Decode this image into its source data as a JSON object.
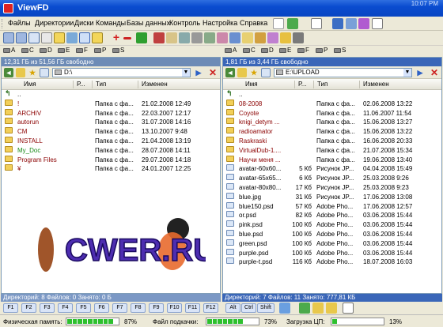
{
  "window": {
    "title": "ViewFD",
    "corner_text": "10:07 PM"
  },
  "menu": [
    "Файлы",
    "Директории",
    "Диски",
    "Команды",
    "Базы данных",
    "Контроль",
    "Настройка",
    "Справка"
  ],
  "drives": [
    "A",
    "C",
    "D",
    "E",
    "F",
    "P",
    "S"
  ],
  "left": {
    "free": "12,31 ГБ из 51,56 ГБ свободно",
    "path": "D:\\",
    "cols": {
      "name": "Имя",
      "size": "Р...",
      "type": "Тип",
      "modified": "Изменен"
    },
    "rows": [
      {
        "name": "..",
        "size": "",
        "type": "",
        "date": "",
        "kind": "up",
        "color": "#000"
      },
      {
        "name": "!",
        "size": "",
        "type": "Папка с фа...",
        "date": "21.02.2008 12:49",
        "kind": "dir",
        "color": "#8b0000"
      },
      {
        "name": "ARCHIV",
        "size": "",
        "type": "Папка с фа...",
        "date": "22.03.2007 12:17",
        "kind": "dir",
        "color": "#8b0000"
      },
      {
        "name": "autorun",
        "size": "",
        "type": "Папка с фа...",
        "date": "31.07.2008 14:16",
        "kind": "dir",
        "color": "#8b0000"
      },
      {
        "name": "CM",
        "size": "",
        "type": "Папка с фа...",
        "date": "13.10.2007 9:48",
        "kind": "dir",
        "color": "#8b0000"
      },
      {
        "name": "INSTALL",
        "size": "",
        "type": "Папка с фа...",
        "date": "21.04.2008 13:19",
        "kind": "dir",
        "color": "#8b0000"
      },
      {
        "name": "My_Doc",
        "size": "",
        "type": "Папка с фа...",
        "date": "28.07.2008 14:11",
        "kind": "dir",
        "color": "#1a8a1a"
      },
      {
        "name": "Program Files",
        "size": "",
        "type": "Папка с фа...",
        "date": "29.07.2008 14:18",
        "kind": "dir",
        "color": "#8b0000"
      },
      {
        "name": "¥",
        "size": "",
        "type": "Папка с фа...",
        "date": "24.01.2007 12:25",
        "kind": "dir",
        "color": "#8b0000"
      }
    ],
    "status": "Директорий: 8   Файлов: 0   Занято: 0 Б"
  },
  "right": {
    "free": "1,81 ГБ из 3,44 ГБ свободно",
    "path": "E:\\UPLOAD",
    "cols": {
      "name": "Имя",
      "size": "Р...",
      "type": "Тип",
      "modified": "Изменен"
    },
    "rows": [
      {
        "name": "..",
        "size": "",
        "type": "",
        "date": "",
        "kind": "up",
        "color": "#000"
      },
      {
        "name": "08-2008",
        "size": "",
        "type": "Папка с фа...",
        "date": "02.06.2008 13:22",
        "kind": "dir",
        "color": "#8b0000"
      },
      {
        "name": "Coyote",
        "size": "",
        "type": "Папка с фа...",
        "date": "11.06.2007 11:54",
        "kind": "dir",
        "color": "#8b0000"
      },
      {
        "name": "knigi_detym ...",
        "size": "",
        "type": "Папка с фа...",
        "date": "15.06.2008 13:27",
        "kind": "dir",
        "color": "#8b0000"
      },
      {
        "name": "radioamator",
        "size": "",
        "type": "Папка с фа...",
        "date": "15.06.2008 13:22",
        "kind": "dir",
        "color": "#8b0000"
      },
      {
        "name": "Raskraski",
        "size": "",
        "type": "Папка с фа...",
        "date": "16.06.2008 20:33",
        "kind": "dir",
        "color": "#8b0000"
      },
      {
        "name": "VirtualDub-1....",
        "size": "",
        "type": "Папка с фа...",
        "date": "21.07.2008 15:34",
        "kind": "dir",
        "color": "#8b0000"
      },
      {
        "name": "Научи меня ...",
        "size": "",
        "type": "Папка с фа...",
        "date": "19.06.2008 13:40",
        "kind": "dir",
        "color": "#8b0000"
      },
      {
        "name": "avatar-60x60...",
        "size": "5 Кб",
        "type": "Рисунок JP...",
        "date": "04.04.2008 15:49",
        "kind": "file",
        "color": "#000"
      },
      {
        "name": "avatar-65x65...",
        "size": "6 Кб",
        "type": "Рисунок JP...",
        "date": "25.03.2008 9:26",
        "kind": "file",
        "color": "#000"
      },
      {
        "name": "avatar-80x80...",
        "size": "17 Кб",
        "type": "Рисунок JP...",
        "date": "25.03.2008 9:23",
        "kind": "file",
        "color": "#000"
      },
      {
        "name": "blue.jpg",
        "size": "31 Кб",
        "type": "Рисунок JP...",
        "date": "17.06.2008 13:08",
        "kind": "file",
        "color": "#000"
      },
      {
        "name": "blue150.psd",
        "size": "57 Кб",
        "type": "Adobe Pho...",
        "date": "17.06.2008 12:57",
        "kind": "file",
        "color": "#000"
      },
      {
        "name": "or.psd",
        "size": "82 Кб",
        "type": "Adobe Pho...",
        "date": "03.06.2008 15:44",
        "kind": "file",
        "color": "#000"
      },
      {
        "name": "pink.psd",
        "size": "100 Кб",
        "type": "Adobe Pho...",
        "date": "03.06.2008 15:44",
        "kind": "file",
        "color": "#000"
      },
      {
        "name": "blue.psd",
        "size": "100 Кб",
        "type": "Adobe Pho...",
        "date": "03.06.2008 15:44",
        "kind": "file",
        "color": "#000"
      },
      {
        "name": "green.psd",
        "size": "100 Кб",
        "type": "Adobe Pho...",
        "date": "03.06.2008 15:44",
        "kind": "file",
        "color": "#000"
      },
      {
        "name": "purple.psd",
        "size": "100 Кб",
        "type": "Adobe Pho...",
        "date": "03.06.2008 15:44",
        "kind": "file",
        "color": "#000"
      },
      {
        "name": "purple-t.psd",
        "size": "116 Кб",
        "type": "Adobe Pho...",
        "date": "18.07.2008 16:03",
        "kind": "file",
        "color": "#000"
      }
    ],
    "status": "Директорий: 7   Файлов: 11   Занято: 777,81 КБ"
  },
  "fkeys": [
    "F1",
    "F2",
    "F3",
    "F4",
    "F5",
    "F6",
    "F7",
    "F8",
    "F9",
    "F10",
    "F11",
    "F12"
  ],
  "mods": [
    "Alt",
    "Ctrl",
    "Shift"
  ],
  "info": {
    "mem_label": "Физическая память:",
    "mem_value": "87%",
    "mem_pct": 87,
    "swap_label": "Файл подкачки:",
    "swap_value": "73%",
    "swap_pct": 73,
    "cpu_label": "Загрузка ЦП:",
    "cpu_value": "13%",
    "cpu_pct": 13
  },
  "logo_text": "CWER.RU"
}
